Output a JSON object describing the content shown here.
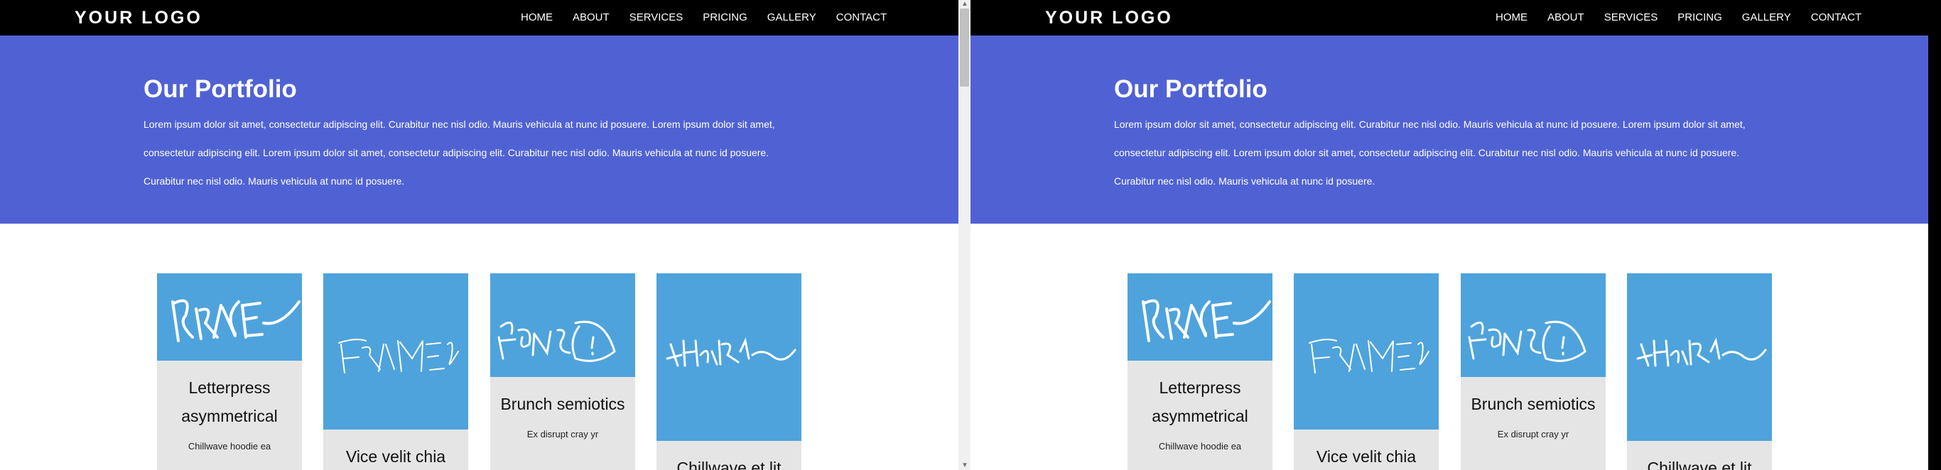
{
  "brand": {
    "logo": "YOUR LOGO",
    "colors": {
      "hero": "#5062d3",
      "card_image": "#4ea3dc",
      "card_body": "#e5e5e5",
      "topbar": "#000000"
    }
  },
  "nav": {
    "items": [
      "HOME",
      "ABOUT",
      "SERVICES",
      "PRICING",
      "GALLERY",
      "CONTACT"
    ]
  },
  "hero": {
    "title": "Our Portfolio",
    "text": "Lorem ipsum dolor sit amet, consectetur adipiscing elit. Curabitur nec nisl odio. Mauris vehicula at nunc id posuere. Lorem ipsum dolor sit amet, consectetur adipiscing elit. Lorem ipsum dolor sit amet, consectetur adipiscing elit. Curabitur nec nisl odio. Mauris vehicula at nunc id posuere. Curabitur nec nisl odio. Mauris vehicula at nunc id posuere."
  },
  "cards": [
    {
      "image_label": "BRACE",
      "title": "Letterpress asymmetrical",
      "desc": "Chillwave hoodie ea"
    },
    {
      "image_label": "FRAMES",
      "title": "Vice velit chia",
      "desc": ""
    },
    {
      "image_label": "FONTS",
      "title": "Brunch semiotics",
      "desc": "Ex disrupt cray yr"
    },
    {
      "image_label": "XHARAK",
      "title": "Chillwave et lit",
      "desc": ""
    }
  ],
  "scrollbar": {
    "up": "▲",
    "down": "▼"
  }
}
